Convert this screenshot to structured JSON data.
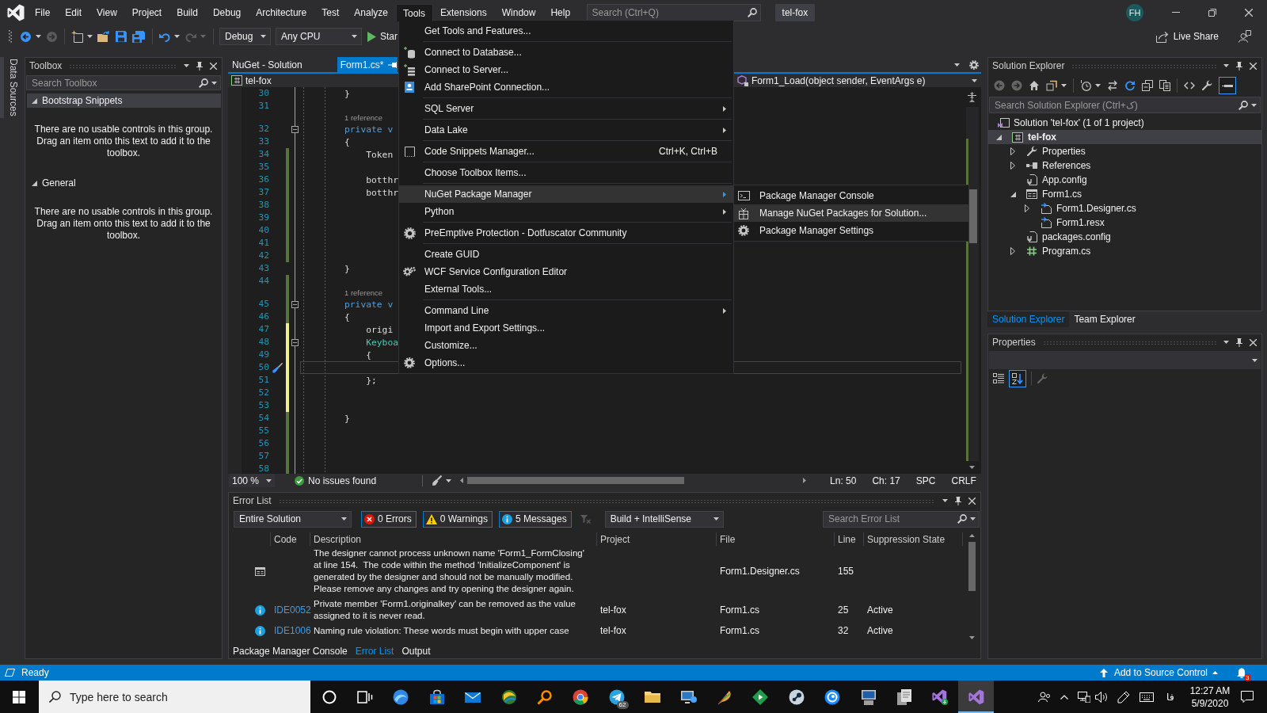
{
  "menu_bar": {
    "items": [
      {
        "label": "File",
        "selected": false
      },
      {
        "label": "Edit",
        "selected": false
      },
      {
        "label": "View",
        "selected": false
      },
      {
        "label": "Project",
        "selected": false
      },
      {
        "label": "Build",
        "selected": false
      },
      {
        "label": "Debug",
        "selected": false
      },
      {
        "label": "Architecture",
        "selected": false
      },
      {
        "label": "Test",
        "selected": false
      },
      {
        "label": "Analyze",
        "selected": false
      },
      {
        "label": "Tools",
        "selected": true
      },
      {
        "label": "Extensions",
        "selected": false
      },
      {
        "label": "Window",
        "selected": false
      },
      {
        "label": "Help",
        "selected": false
      }
    ],
    "search": {
      "placeholder": "Search (Ctrl+Q)"
    },
    "solution_name": "tel-fox",
    "avatar": "FH"
  },
  "tools_menu": {
    "groups": [
      [
        {
          "label": "Get Tools and Features...",
          "submenu": false,
          "selected": false
        }
      ],
      [
        {
          "label": "Connect to Database...",
          "submenu": false,
          "selected": false
        },
        {
          "label": "Connect to Server...",
          "submenu": false,
          "selected": false
        },
        {
          "label": "Add SharePoint Connection...",
          "submenu": false,
          "selected": false
        }
      ],
      [
        {
          "label": "SQL Server",
          "submenu": true,
          "selected": false
        }
      ],
      [
        {
          "label": "Data Lake",
          "submenu": true,
          "selected": false
        }
      ],
      [
        {
          "label": "Code Snippets Manager...",
          "shortcut": "Ctrl+K, Ctrl+B",
          "submenu": false,
          "selected": false
        }
      ],
      [
        {
          "label": "Choose Toolbox Items...",
          "submenu": false,
          "selected": false
        }
      ],
      [
        {
          "label": "NuGet Package Manager",
          "submenu": true,
          "selected": true,
          "children": [
            {
              "label": "Package Manager Console",
              "selected": false
            },
            {
              "label": "Manage NuGet Packages for Solution...",
              "selected": true
            },
            {
              "label": "Package Manager Settings",
              "selected": false
            }
          ]
        },
        {
          "label": "Python",
          "submenu": true,
          "selected": false
        }
      ],
      [
        {
          "label": "PreEmptive Protection - Dotfuscator Community",
          "submenu": false,
          "selected": false
        }
      ],
      [
        {
          "label": "Create GUID",
          "submenu": false,
          "selected": false
        },
        {
          "label": "WCF Service Configuration Editor",
          "submenu": false,
          "selected": false
        },
        {
          "label": "External Tools...",
          "submenu": false,
          "selected": false
        }
      ],
      [
        {
          "label": "Command Line",
          "submenu": true,
          "selected": false
        },
        {
          "label": "Import and Export Settings...",
          "submenu": false,
          "selected": false
        },
        {
          "label": "Customize...",
          "submenu": false,
          "selected": false
        },
        {
          "label": "Options...",
          "submenu": false,
          "selected": false
        }
      ]
    ]
  },
  "toolbar": {
    "configuration": "Debug",
    "platform": "Any CPU",
    "start": "Star",
    "live_share": "Live Share"
  },
  "side_tabs": [
    {
      "label": "Data Sources"
    }
  ],
  "toolbox": {
    "title": "Toolbox",
    "search": {
      "placeholder": "Search Toolbox"
    },
    "groups": [
      {
        "name": "Bootstrap Snippets",
        "expanded": true,
        "selected": true,
        "message": "There are no usable controls in this group. Drag an item onto this text to add it to the toolbox."
      },
      {
        "name": "General",
        "expanded": true,
        "selected": false,
        "message": "There are no usable controls in this group. Drag an item onto this text to add it to the toolbox."
      }
    ]
  },
  "editor": {
    "tabs": [
      {
        "label": "NuGet - Solution",
        "selected": false
      },
      {
        "label": "Form1.cs*",
        "selected": true
      }
    ],
    "project": "tel-fox",
    "member": "Form1_Load(object sender, EventArgs e)",
    "lines": [
      {
        "kind": "plain",
        "number": "30",
        "text": "}",
        "fold": false,
        "current": false,
        "quick_action": false
      },
      {
        "kind": "blank",
        "number": "31",
        "fold": false,
        "current": false,
        "quick_action": false
      },
      {
        "kind": "codelens",
        "text": "1 reference"
      },
      {
        "kind": "keyword",
        "number": "32",
        "text": "private v",
        "fold": true,
        "current": false,
        "quick_action": false
      },
      {
        "kind": "plain",
        "number": "33",
        "text": "{",
        "fold": false,
        "current": false,
        "quick_action": false
      },
      {
        "kind": "plain",
        "number": "34",
        "text": "    Token",
        "color": "#57743a",
        "fold": false,
        "current": false,
        "quick_action": false
      },
      {
        "kind": "blank",
        "number": "35",
        "color": "#57743a",
        "fold": false,
        "current": false,
        "quick_action": false
      },
      {
        "kind": "plain",
        "number": "36",
        "text": "    botthr",
        "color": "#57743a",
        "fold": false,
        "current": false,
        "quick_action": false
      },
      {
        "kind": "plain",
        "number": "37",
        "text": "    botthr",
        "color": "#57743a",
        "fold": false,
        "current": false,
        "quick_action": false
      },
      {
        "kind": "blank",
        "number": "38",
        "color": "#57743a",
        "fold": false,
        "current": false,
        "quick_action": false
      },
      {
        "kind": "blank",
        "number": "39",
        "color": "#57743a",
        "fold": false,
        "current": false,
        "quick_action": false
      },
      {
        "kind": "blank",
        "number": "40",
        "color": "#57743a",
        "fold": false,
        "current": false,
        "quick_action": false
      },
      {
        "kind": "blank",
        "number": "41",
        "color": "#57743a",
        "fold": false,
        "current": false,
        "quick_action": false
      },
      {
        "kind": "blank",
        "number": "42",
        "color": "#57743a",
        "fold": false,
        "current": false,
        "quick_action": false
      },
      {
        "kind": "plain",
        "number": "43",
        "text": "}",
        "fold": false,
        "current": false,
        "quick_action": false
      },
      {
        "kind": "blank",
        "number": "44",
        "color": "#57743a",
        "fold": false,
        "current": false,
        "quick_action": false
      },
      {
        "kind": "codelens",
        "text": "1 reference",
        "color": "#57743a"
      },
      {
        "kind": "keyword",
        "number": "45",
        "text": "private v",
        "color": "#57743a",
        "fold": true,
        "current": false,
        "quick_action": false
      },
      {
        "kind": "plain",
        "number": "46",
        "text": "{",
        "color": "#57743a",
        "fold": false,
        "current": false,
        "quick_action": false
      },
      {
        "kind": "plain",
        "number": "47",
        "text": "    origi",
        "color": "#efef8f",
        "fold": false,
        "current": false,
        "quick_action": false
      },
      {
        "kind": "type",
        "number": "48",
        "text": "    Keyboa",
        "color": "#efef8f",
        "fold": true,
        "current": false,
        "quick_action": false
      },
      {
        "kind": "plain",
        "number": "49",
        "text": "    {",
        "color": "#efef8f",
        "fold": false,
        "current": false,
        "quick_action": false
      },
      {
        "kind": "blank",
        "number": "50",
        "color": "#efef8f",
        "fold": false,
        "current": true,
        "quick_action": true
      },
      {
        "kind": "plain",
        "number": "51",
        "text": "    };",
        "color": "#efef8f",
        "fold": false,
        "current": false,
        "quick_action": false
      },
      {
        "kind": "blank",
        "number": "52",
        "color": "#efef8f",
        "fold": false,
        "current": false,
        "quick_action": false
      },
      {
        "kind": "blank",
        "number": "53",
        "color": "#efef8f",
        "fold": false,
        "current": false,
        "quick_action": false
      },
      {
        "kind": "plain",
        "number": "54",
        "text": "}",
        "color": "#57743a",
        "fold": false,
        "current": false,
        "quick_action": false
      },
      {
        "kind": "blank",
        "number": "55",
        "color": "#57743a",
        "fold": false,
        "current": false,
        "quick_action": false
      },
      {
        "kind": "blank",
        "number": "56",
        "color": "#57743a",
        "fold": false,
        "current": false,
        "quick_action": false
      },
      {
        "kind": "blank",
        "number": "57",
        "color": "#57743a",
        "fold": false,
        "current": false,
        "quick_action": false
      },
      {
        "kind": "blank",
        "number": "58",
        "color": "#57743a",
        "fold": false,
        "current": false,
        "quick_action": false
      }
    ],
    "zoom": "100 %",
    "issues": "No issues found",
    "status_items": [
      "Ln: 50",
      "Ch: 17",
      "SPC",
      "CRLF"
    ]
  },
  "error_list": {
    "title": "Error List",
    "scope": "Entire Solution",
    "filters": [
      {
        "kind": "error",
        "label": "0 Errors",
        "on": true
      },
      {
        "kind": "warning",
        "label": "0 Warnings",
        "on": true
      },
      {
        "kind": "message",
        "label": "5 Messages",
        "on": true
      }
    ],
    "build_filter": "Build + IntelliSense",
    "search": {
      "placeholder": "Search Error List"
    },
    "columns": [
      "Code",
      "Description",
      "Project",
      "File",
      "Line",
      "Suppression State"
    ],
    "rows": [
      {
        "kind": "designer",
        "description": "The designer cannot process unknown name 'Form1_FormClosing' at line 154.  The code within the method 'InitializeComponent' is generated by the designer and should not be manually modified. Please remove any changes and try opening the designer again.",
        "file": "Form1.Designer.cs",
        "line": "155"
      },
      {
        "kind": "message",
        "code": "IDE0052",
        "description": "Private member 'Form1.originalkey' can be removed as the value assigned to it is never read.",
        "project": "tel-fox",
        "file": "Form1.cs",
        "line": "25",
        "suppression": "Active"
      },
      {
        "kind": "message",
        "code": "IDE1006",
        "description": "Naming rule violation: These words must begin with upper case",
        "project": "tel-fox",
        "file": "Form1.cs",
        "line": "32",
        "suppression": "Active"
      }
    ]
  },
  "bottom_tabs": [
    {
      "label": "Package Manager Console",
      "selected": false
    },
    {
      "label": "Error List",
      "selected": true
    },
    {
      "label": "Output",
      "selected": false
    }
  ],
  "solution_explorer": {
    "title": "Solution Explorer",
    "toolbar": [
      {
        "selected": false,
        "disabled": true
      },
      {
        "selected": false,
        "disabled": true
      },
      {
        "selected": false,
        "disabled": false
      },
      {
        "selected": false,
        "disabled": false
      },
      {
        "selected": false,
        "disabled": false
      },
      {
        "selected": false,
        "disabled": false
      },
      {
        "selected": false,
        "disabled": false
      },
      {
        "selected": false,
        "disabled": false
      },
      {
        "selected": false,
        "disabled": false
      },
      {
        "selected": false,
        "disabled": false
      },
      {
        "selected": false,
        "disabled": false
      },
      {
        "selected": true,
        "disabled": false
      }
    ],
    "search": {
      "placeholder": "Search Solution Explorer (Ctrl+ک)"
    },
    "tree": [
      {
        "label": "Solution 'tel-fox' (1 of 1 project)",
        "kind": "solution",
        "selected": false,
        "children": [
          {
            "label": "tel-fox",
            "kind": "project",
            "expanded": true,
            "selected": true,
            "children": [
              {
                "label": "Properties",
                "kind": "properties",
                "expanded": false,
                "selected": false
              },
              {
                "label": "References",
                "kind": "references",
                "expanded": false,
                "selected": false
              },
              {
                "label": "App.config",
                "kind": "config",
                "selected": false
              },
              {
                "label": "Form1.cs",
                "kind": "form",
                "expanded": true,
                "selected": false,
                "children": [
                  {
                    "label": "Form1.Designer.cs",
                    "kind": "generated",
                    "expanded": false,
                    "selected": false
                  },
                  {
                    "label": "Form1.resx",
                    "kind": "generated",
                    "selected": false
                  }
                ]
              },
              {
                "label": "packages.config",
                "kind": "config",
                "selected": false
              },
              {
                "label": "Program.cs",
                "kind": "csharp",
                "expanded": false,
                "selected": false
              }
            ]
          }
        ]
      }
    ],
    "tabs": [
      {
        "label": "Solution Explorer",
        "selected": true
      },
      {
        "label": "Team Explorer",
        "selected": false
      }
    ]
  },
  "properties": {
    "title": "Properties",
    "toolbar": [
      {
        "selected": false,
        "disabled": false
      },
      {
        "selected": true,
        "disabled": false
      },
      {
        "selected": false,
        "disabled": true
      }
    ]
  },
  "status_bar": {
    "text": "Ready",
    "source_control": "Add to Source Control",
    "notifications": "3"
  },
  "taskbar": {
    "search": {
      "placeholder": "Type here to search"
    },
    "apps": [
      {
        "active": false
      },
      {
        "active": false
      },
      {
        "active": false
      },
      {
        "active": false
      },
      {
        "active": false
      },
      {
        "active": false
      },
      {
        "active": false
      },
      {
        "active": false
      },
      {
        "active": false,
        "badge": "62"
      },
      {
        "active": false
      },
      {
        "active": false
      },
      {
        "active": false
      },
      {
        "active": false
      },
      {
        "active": false
      },
      {
        "active": false
      },
      {
        "active": false
      },
      {
        "active": false
      },
      {
        "active": false
      },
      {
        "active": true
      }
    ],
    "tray": {
      "language": "فا",
      "time": "12:27 AM",
      "date": "5/9/2020"
    }
  }
}
